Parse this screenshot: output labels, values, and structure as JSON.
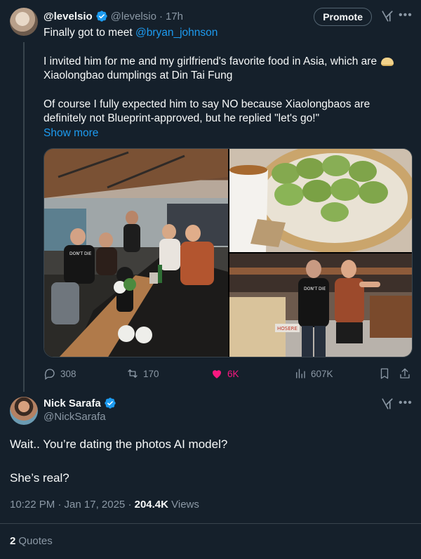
{
  "tweet": {
    "author_name": "@levelsio",
    "author_handle": "@levelsio",
    "dot": "·",
    "time": "17h",
    "promote_label": "Promote",
    "line1_prefix": "Finally got to meet ",
    "mention": "@bryan_johnson",
    "para2": "I invited him for me and my girlfriend's favorite food in Asia, which are",
    "para2_line2": "Xiaolongbao dumplings at Din Tai Fung",
    "para3": "Of course I fully expected him to say NO because Xiaolongbaos are definitely not Blueprint-approved, but he replied \"let's go!\"",
    "show_more": "Show more",
    "shirt_text": "DON'T DIE",
    "sign_text": "HOSERE",
    "stats": {
      "replies": "308",
      "reposts": "170",
      "likes": "6K",
      "views": "607K"
    },
    "colors": {
      "like": "#f91880",
      "link": "#1d9bf0",
      "muted": "#8b98a5"
    }
  },
  "reply": {
    "author_name": "Nick Sarafa",
    "author_handle": "@NickSarafa",
    "line1": "Wait.. You’re dating the photos AI model?",
    "line2": "She’s real?",
    "time": "10:22 PM · Jan 17, 2025 · ",
    "views_count": "204.4K",
    "views_label": " Views",
    "quotes_count": "2",
    "quotes_label": "Quotes"
  }
}
